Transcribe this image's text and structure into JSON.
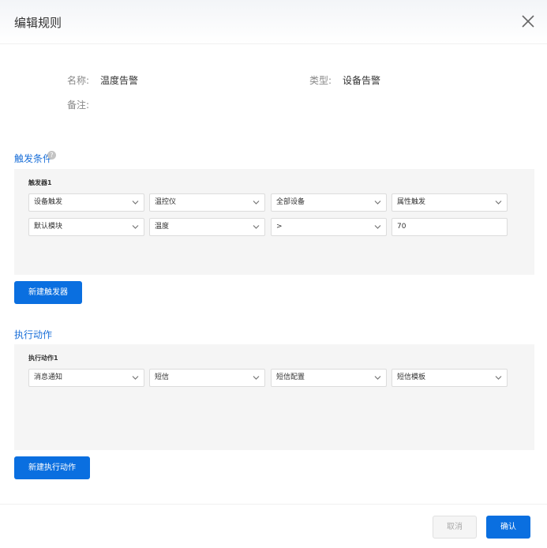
{
  "dialog": {
    "title": "编辑规则"
  },
  "info": {
    "name_label": "名称:",
    "name_value": "温度告警",
    "type_label": "类型:",
    "type_value": "设备告警",
    "remark_label": "备注:"
  },
  "trigger_section": {
    "title": "触发条件",
    "help_glyph": "?",
    "panel_label": "触发器1",
    "row1": [
      "设备触发",
      "温控仪",
      "全部设备",
      "属性触发"
    ],
    "row2": [
      "默认模块",
      "温度",
      ">"
    ],
    "value_input": "70",
    "new_button": "新建触发器"
  },
  "action_section": {
    "title": "执行动作",
    "panel_label": "执行动作1",
    "row1": [
      "消息通知",
      "短信",
      "短信配置",
      "短信模板"
    ],
    "new_button": "新建执行动作"
  },
  "footer": {
    "cancel_label": "取消",
    "confirm_label": "确认"
  },
  "icons": {
    "close": "close-icon",
    "chevron": "chevron-down-icon",
    "help": "question-circle-icon"
  }
}
